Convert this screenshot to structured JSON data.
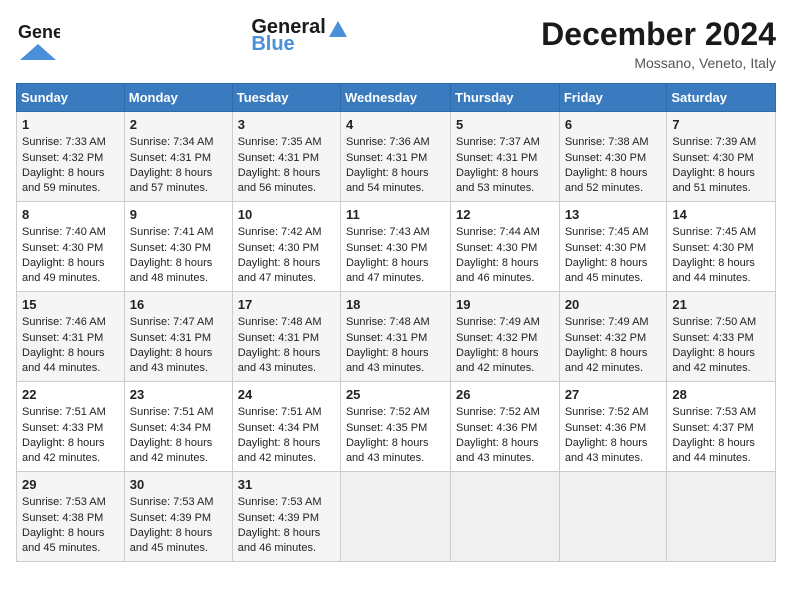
{
  "header": {
    "logo_general": "General",
    "logo_blue": "Blue",
    "month": "December 2024",
    "location": "Mossano, Veneto, Italy"
  },
  "days_of_week": [
    "Sunday",
    "Monday",
    "Tuesday",
    "Wednesday",
    "Thursday",
    "Friday",
    "Saturday"
  ],
  "weeks": [
    [
      {
        "day": 1,
        "sunrise": "7:33 AM",
        "sunset": "4:32 PM",
        "daylight": "8 hours and 59 minutes."
      },
      {
        "day": 2,
        "sunrise": "7:34 AM",
        "sunset": "4:31 PM",
        "daylight": "8 hours and 57 minutes."
      },
      {
        "day": 3,
        "sunrise": "7:35 AM",
        "sunset": "4:31 PM",
        "daylight": "8 hours and 56 minutes."
      },
      {
        "day": 4,
        "sunrise": "7:36 AM",
        "sunset": "4:31 PM",
        "daylight": "8 hours and 54 minutes."
      },
      {
        "day": 5,
        "sunrise": "7:37 AM",
        "sunset": "4:31 PM",
        "daylight": "8 hours and 53 minutes."
      },
      {
        "day": 6,
        "sunrise": "7:38 AM",
        "sunset": "4:30 PM",
        "daylight": "8 hours and 52 minutes."
      },
      {
        "day": 7,
        "sunrise": "7:39 AM",
        "sunset": "4:30 PM",
        "daylight": "8 hours and 51 minutes."
      }
    ],
    [
      {
        "day": 8,
        "sunrise": "7:40 AM",
        "sunset": "4:30 PM",
        "daylight": "8 hours and 49 minutes."
      },
      {
        "day": 9,
        "sunrise": "7:41 AM",
        "sunset": "4:30 PM",
        "daylight": "8 hours and 48 minutes."
      },
      {
        "day": 10,
        "sunrise": "7:42 AM",
        "sunset": "4:30 PM",
        "daylight": "8 hours and 47 minutes."
      },
      {
        "day": 11,
        "sunrise": "7:43 AM",
        "sunset": "4:30 PM",
        "daylight": "8 hours and 47 minutes."
      },
      {
        "day": 12,
        "sunrise": "7:44 AM",
        "sunset": "4:30 PM",
        "daylight": "8 hours and 46 minutes."
      },
      {
        "day": 13,
        "sunrise": "7:45 AM",
        "sunset": "4:30 PM",
        "daylight": "8 hours and 45 minutes."
      },
      {
        "day": 14,
        "sunrise": "7:45 AM",
        "sunset": "4:30 PM",
        "daylight": "8 hours and 44 minutes."
      }
    ],
    [
      {
        "day": 15,
        "sunrise": "7:46 AM",
        "sunset": "4:31 PM",
        "daylight": "8 hours and 44 minutes."
      },
      {
        "day": 16,
        "sunrise": "7:47 AM",
        "sunset": "4:31 PM",
        "daylight": "8 hours and 43 minutes."
      },
      {
        "day": 17,
        "sunrise": "7:48 AM",
        "sunset": "4:31 PM",
        "daylight": "8 hours and 43 minutes."
      },
      {
        "day": 18,
        "sunrise": "7:48 AM",
        "sunset": "4:31 PM",
        "daylight": "8 hours and 43 minutes."
      },
      {
        "day": 19,
        "sunrise": "7:49 AM",
        "sunset": "4:32 PM",
        "daylight": "8 hours and 42 minutes."
      },
      {
        "day": 20,
        "sunrise": "7:49 AM",
        "sunset": "4:32 PM",
        "daylight": "8 hours and 42 minutes."
      },
      {
        "day": 21,
        "sunrise": "7:50 AM",
        "sunset": "4:33 PM",
        "daylight": "8 hours and 42 minutes."
      }
    ],
    [
      {
        "day": 22,
        "sunrise": "7:51 AM",
        "sunset": "4:33 PM",
        "daylight": "8 hours and 42 minutes."
      },
      {
        "day": 23,
        "sunrise": "7:51 AM",
        "sunset": "4:34 PM",
        "daylight": "8 hours and 42 minutes."
      },
      {
        "day": 24,
        "sunrise": "7:51 AM",
        "sunset": "4:34 PM",
        "daylight": "8 hours and 42 minutes."
      },
      {
        "day": 25,
        "sunrise": "7:52 AM",
        "sunset": "4:35 PM",
        "daylight": "8 hours and 43 minutes."
      },
      {
        "day": 26,
        "sunrise": "7:52 AM",
        "sunset": "4:36 PM",
        "daylight": "8 hours and 43 minutes."
      },
      {
        "day": 27,
        "sunrise": "7:52 AM",
        "sunset": "4:36 PM",
        "daylight": "8 hours and 43 minutes."
      },
      {
        "day": 28,
        "sunrise": "7:53 AM",
        "sunset": "4:37 PM",
        "daylight": "8 hours and 44 minutes."
      }
    ],
    [
      {
        "day": 29,
        "sunrise": "7:53 AM",
        "sunset": "4:38 PM",
        "daylight": "8 hours and 45 minutes."
      },
      {
        "day": 30,
        "sunrise": "7:53 AM",
        "sunset": "4:39 PM",
        "daylight": "8 hours and 45 minutes."
      },
      {
        "day": 31,
        "sunrise": "7:53 AM",
        "sunset": "4:39 PM",
        "daylight": "8 hours and 46 minutes."
      },
      null,
      null,
      null,
      null
    ]
  ]
}
